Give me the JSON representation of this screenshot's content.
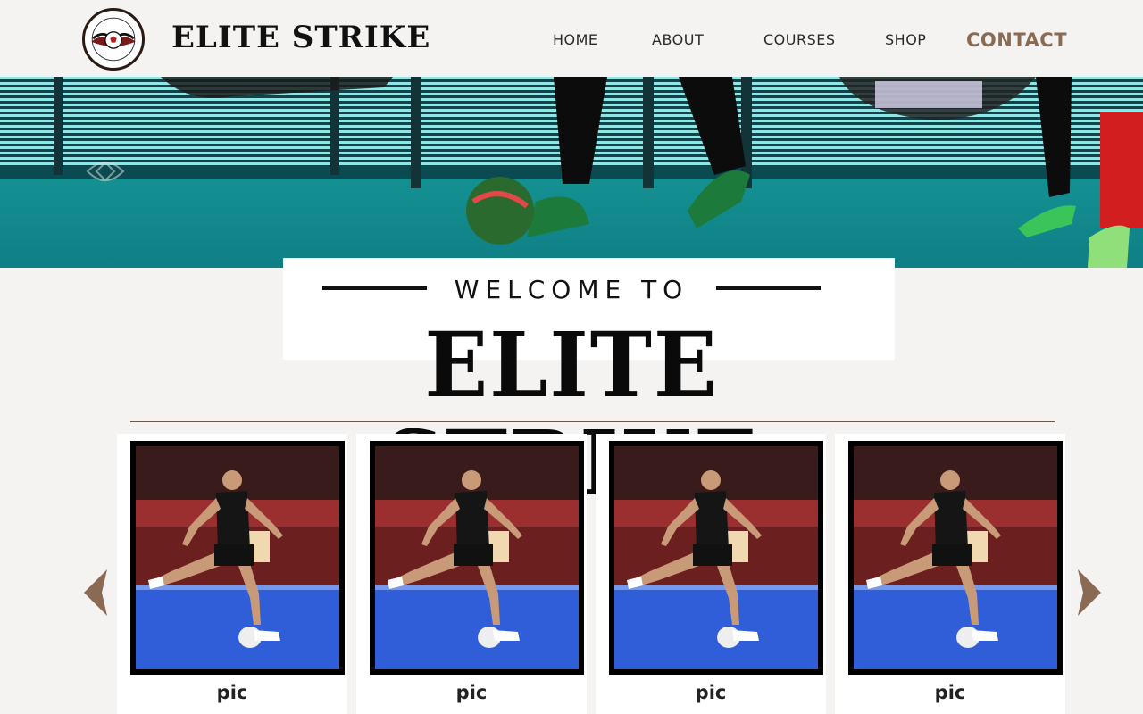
{
  "header": {
    "brand": "ELITE STRIKE",
    "logo_icon": "elite-strike-futsal-logo",
    "nav": {
      "home": "HOME",
      "about": "ABOUT",
      "courses": "COURSES",
      "shop": "SHOP",
      "contact": "CONTACT"
    }
  },
  "hero": {
    "image": "futsal-players-feet-with-ball"
  },
  "welcome": {
    "subtitle": "WELCOME TO",
    "title": "ELITE STRIKE"
  },
  "carousel": {
    "prev_icon": "chevron-left-icon",
    "next_icon": "chevron-right-icon",
    "cards": [
      {
        "label": "pic",
        "image": "futsal-player-kicking-ball"
      },
      {
        "label": "pic",
        "image": "futsal-player-kicking-ball"
      },
      {
        "label": "pic",
        "image": "futsal-player-kicking-ball"
      },
      {
        "label": "pic",
        "image": "futsal-player-kicking-ball"
      }
    ]
  },
  "colors": {
    "background": "#f4f3f1",
    "accent": "#8a6a52",
    "text": "#111111"
  }
}
